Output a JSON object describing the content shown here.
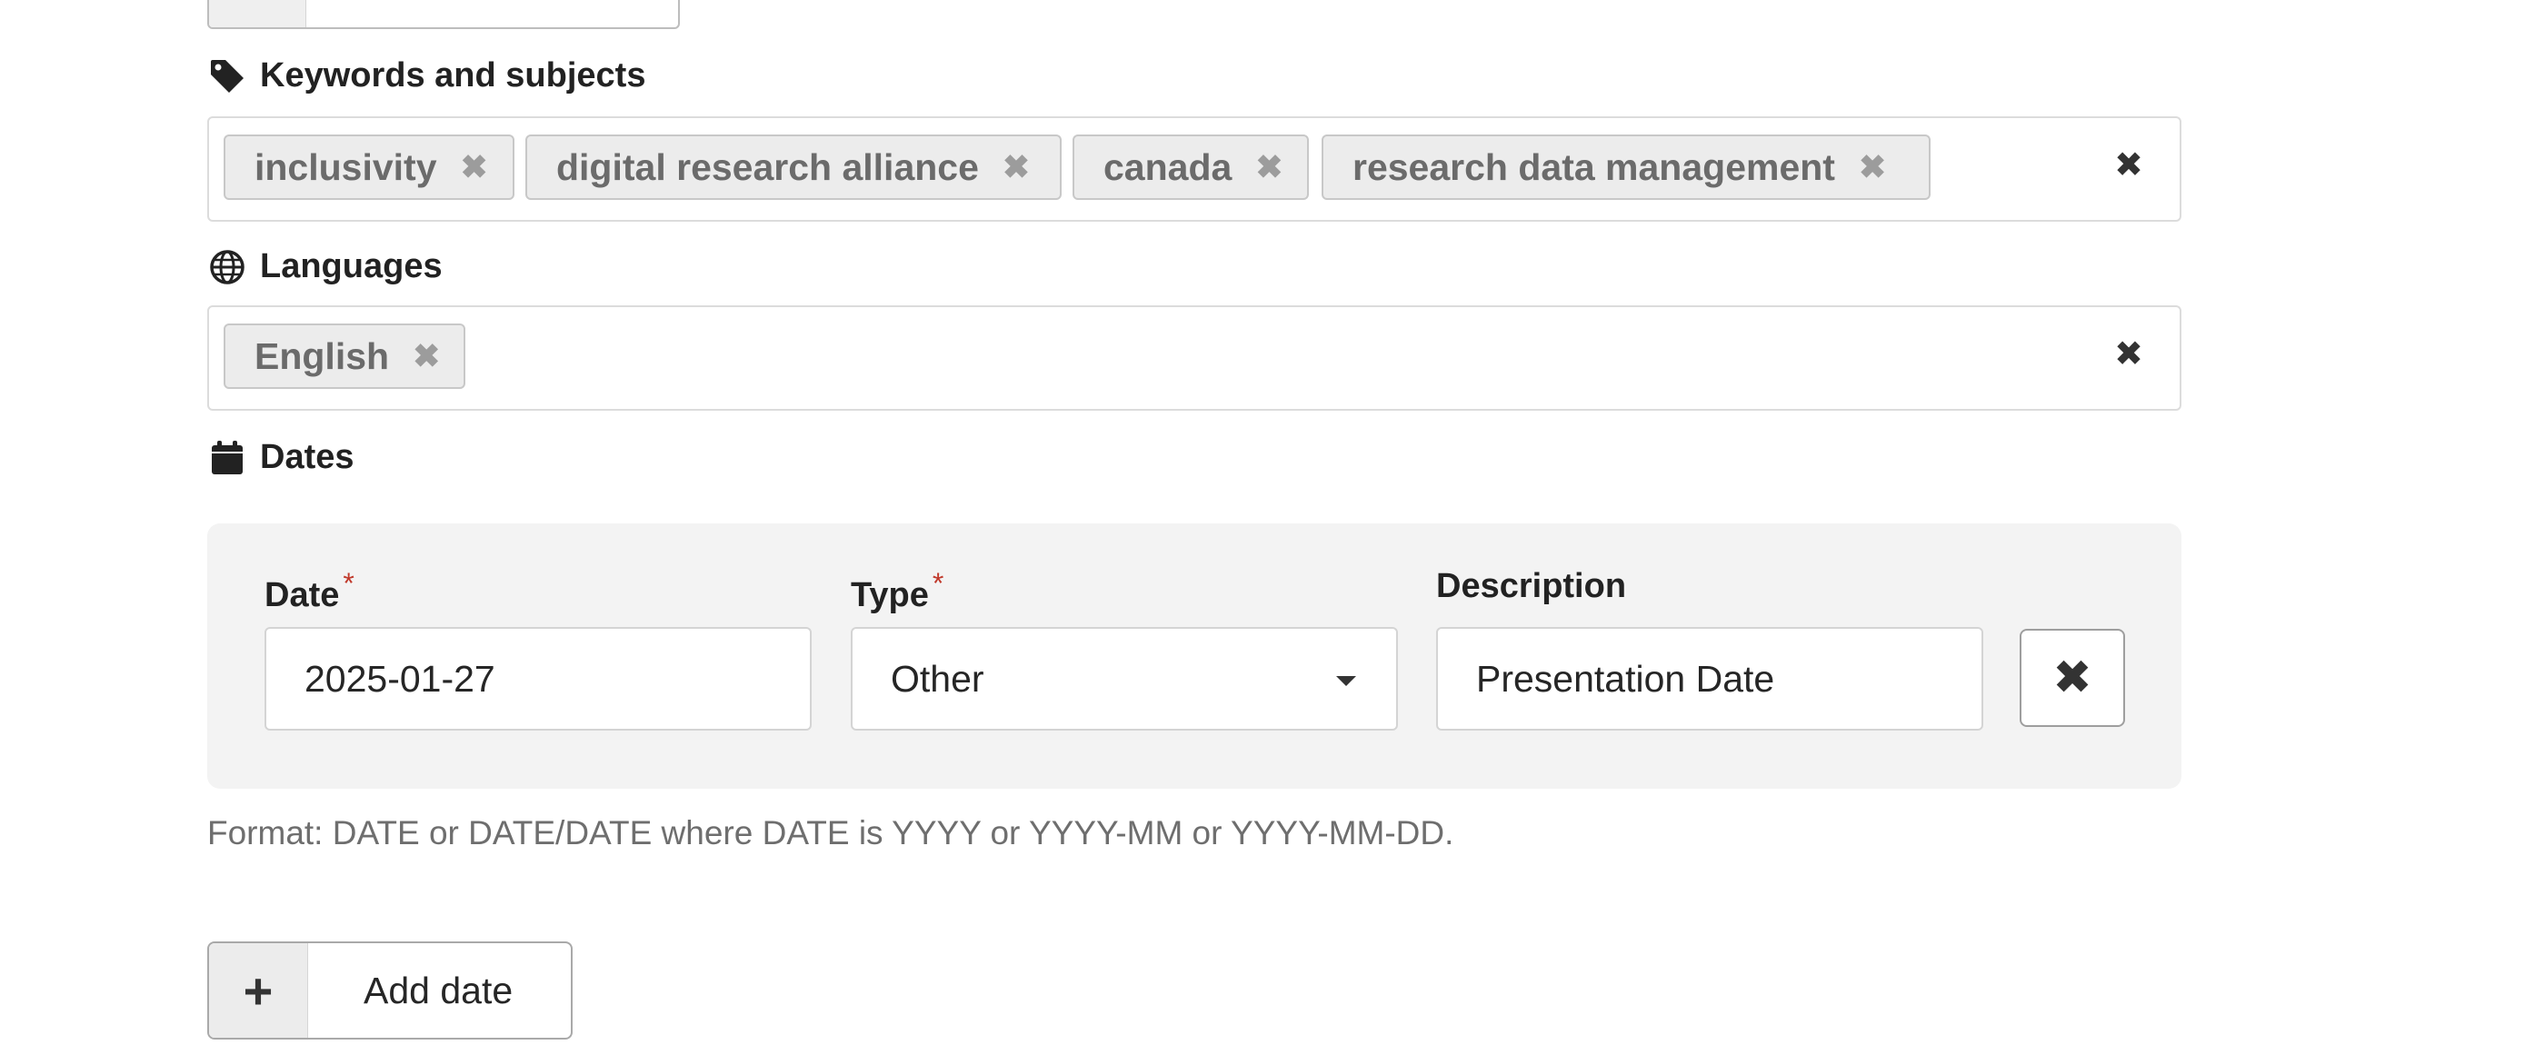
{
  "keywords": {
    "heading": "Keywords and subjects",
    "icon": "tag-icon",
    "chips": [
      "inclusivity",
      "digital research alliance",
      "canada",
      "research data management"
    ],
    "remove_glyph": "✖",
    "clear_glyph": "✖"
  },
  "languages": {
    "heading": "Languages",
    "icon": "globe-icon",
    "chips": [
      "English"
    ],
    "remove_glyph": "✖",
    "clear_glyph": "✖"
  },
  "dates": {
    "heading": "Dates",
    "icon": "calendar-icon",
    "row": {
      "date_label": "Date",
      "date_value": "2025-01-27",
      "type_label": "Type",
      "type_value": "Other",
      "description_label": "Description",
      "description_value": "Presentation Date",
      "required_mark": "*",
      "delete_glyph": "✖"
    },
    "format_hint": "Format: DATE or DATE/DATE where DATE is YYYY or YYYY-MM or YYYY-MM-DD.",
    "add_button": {
      "plus": "+",
      "label": "Add date"
    }
  },
  "colors": {
    "required": "#c0392b",
    "chip_bg": "#ececec",
    "panel_bg": "#f3f3f3"
  }
}
